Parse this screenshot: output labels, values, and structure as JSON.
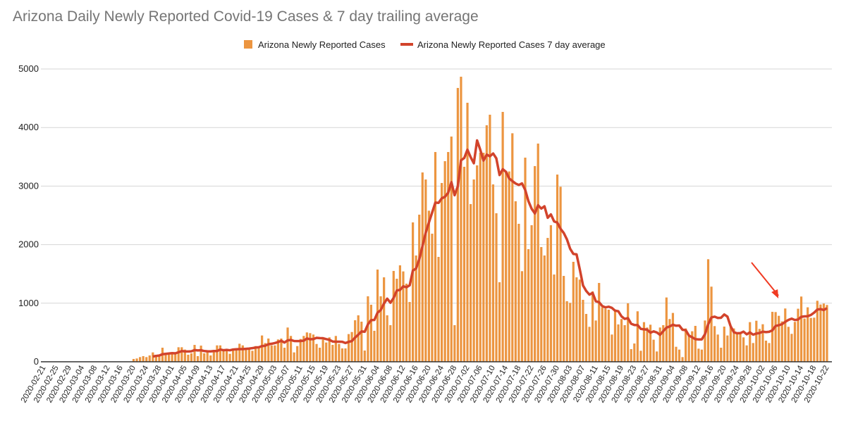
{
  "chart_data": {
    "type": "bar",
    "title": "Arizona Daily Newly Reported Covid-19 Cases & 7 day trailing average",
    "xlabel": "",
    "ylabel": "",
    "ylim": [
      0,
      5000
    ],
    "yticks": [
      0,
      1000,
      2000,
      3000,
      4000,
      5000
    ],
    "grid": true,
    "legend_position": "top",
    "colors": {
      "bars": "#ec9540",
      "line": "#d2432b",
      "annotation_arrow": "#f03a22",
      "grid": "#d6d6d6",
      "axis": "#333333"
    },
    "annotation": {
      "kind": "arrow",
      "points_to": "2020-10-06"
    },
    "tick_every_n_days": 4,
    "series": [
      {
        "name": "Arizona Newly Reported Cases",
        "type": "bar"
      },
      {
        "name": "Arizona Newly Reported Cases 7 day average",
        "type": "line",
        "window": 7
      }
    ],
    "x": [
      "2020-02-21",
      "2020-02-22",
      "2020-02-23",
      "2020-02-24",
      "2020-02-25",
      "2020-02-26",
      "2020-02-27",
      "2020-02-28",
      "2020-02-29",
      "2020-03-01",
      "2020-03-02",
      "2020-03-03",
      "2020-03-04",
      "2020-03-05",
      "2020-03-06",
      "2020-03-07",
      "2020-03-08",
      "2020-03-09",
      "2020-03-10",
      "2020-03-11",
      "2020-03-12",
      "2020-03-13",
      "2020-03-14",
      "2020-03-15",
      "2020-03-16",
      "2020-03-17",
      "2020-03-18",
      "2020-03-19",
      "2020-03-20",
      "2020-03-21",
      "2020-03-22",
      "2020-03-23",
      "2020-03-24",
      "2020-03-25",
      "2020-03-26",
      "2020-03-27",
      "2020-03-28",
      "2020-03-29",
      "2020-03-30",
      "2020-03-31",
      "2020-04-01",
      "2020-04-02",
      "2020-04-03",
      "2020-04-04",
      "2020-04-05",
      "2020-04-06",
      "2020-04-07",
      "2020-04-08",
      "2020-04-09",
      "2020-04-10",
      "2020-04-11",
      "2020-04-12",
      "2020-04-13",
      "2020-04-14",
      "2020-04-15",
      "2020-04-16",
      "2020-04-17",
      "2020-04-18",
      "2020-04-19",
      "2020-04-20",
      "2020-04-21",
      "2020-04-22",
      "2020-04-23",
      "2020-04-24",
      "2020-04-25",
      "2020-04-26",
      "2020-04-27",
      "2020-04-28",
      "2020-04-29",
      "2020-04-30",
      "2020-05-01",
      "2020-05-02",
      "2020-05-03",
      "2020-05-04",
      "2020-05-05",
      "2020-05-06",
      "2020-05-07",
      "2020-05-08",
      "2020-05-09",
      "2020-05-10",
      "2020-05-11",
      "2020-05-12",
      "2020-05-13",
      "2020-05-14",
      "2020-05-15",
      "2020-05-16",
      "2020-05-17",
      "2020-05-18",
      "2020-05-19",
      "2020-05-20",
      "2020-05-21",
      "2020-05-22",
      "2020-05-23",
      "2020-05-24",
      "2020-05-25",
      "2020-05-26",
      "2020-05-27",
      "2020-05-28",
      "2020-05-29",
      "2020-05-30",
      "2020-05-31",
      "2020-06-01",
      "2020-06-02",
      "2020-06-03",
      "2020-06-04",
      "2020-06-05",
      "2020-06-06",
      "2020-06-07",
      "2020-06-08",
      "2020-06-09",
      "2020-06-10",
      "2020-06-11",
      "2020-06-12",
      "2020-06-13",
      "2020-06-14",
      "2020-06-15",
      "2020-06-16",
      "2020-06-17",
      "2020-06-18",
      "2020-06-19",
      "2020-06-20",
      "2020-06-21",
      "2020-06-22",
      "2020-06-23",
      "2020-06-24",
      "2020-06-25",
      "2020-06-26",
      "2020-06-27",
      "2020-06-28",
      "2020-06-29",
      "2020-06-30",
      "2020-07-01",
      "2020-07-02",
      "2020-07-03",
      "2020-07-04",
      "2020-07-05",
      "2020-07-06",
      "2020-07-07",
      "2020-07-08",
      "2020-07-09",
      "2020-07-10",
      "2020-07-11",
      "2020-07-12",
      "2020-07-13",
      "2020-07-14",
      "2020-07-15",
      "2020-07-16",
      "2020-07-17",
      "2020-07-18",
      "2020-07-19",
      "2020-07-20",
      "2020-07-21",
      "2020-07-22",
      "2020-07-23",
      "2020-07-24",
      "2020-07-25",
      "2020-07-26",
      "2020-07-27",
      "2020-07-28",
      "2020-07-29",
      "2020-07-30",
      "2020-07-31",
      "2020-08-01",
      "2020-08-02",
      "2020-08-03",
      "2020-08-04",
      "2020-08-05",
      "2020-08-06",
      "2020-08-07",
      "2020-08-08",
      "2020-08-09",
      "2020-08-10",
      "2020-08-11",
      "2020-08-12",
      "2020-08-13",
      "2020-08-14",
      "2020-08-15",
      "2020-08-16",
      "2020-08-17",
      "2020-08-18",
      "2020-08-19",
      "2020-08-20",
      "2020-08-21",
      "2020-08-22",
      "2020-08-23",
      "2020-08-24",
      "2020-08-25",
      "2020-08-26",
      "2020-08-27",
      "2020-08-28",
      "2020-08-29",
      "2020-08-30",
      "2020-08-31",
      "2020-09-01",
      "2020-09-02",
      "2020-09-03",
      "2020-09-04",
      "2020-09-05",
      "2020-09-06",
      "2020-09-07",
      "2020-09-08",
      "2020-09-09",
      "2020-09-10",
      "2020-09-11",
      "2020-09-12",
      "2020-09-13",
      "2020-09-14",
      "2020-09-15",
      "2020-09-16",
      "2020-09-17",
      "2020-09-18",
      "2020-09-19",
      "2020-09-20",
      "2020-09-21",
      "2020-09-22",
      "2020-09-23",
      "2020-09-24",
      "2020-09-25",
      "2020-09-26",
      "2020-09-27",
      "2020-09-28",
      "2020-09-29",
      "2020-09-30",
      "2020-10-01",
      "2020-10-02",
      "2020-10-03",
      "2020-10-04",
      "2020-10-05",
      "2020-10-06",
      "2020-10-07",
      "2020-10-08",
      "2020-10-09",
      "2020-10-10",
      "2020-10-11",
      "2020-10-12",
      "2020-10-13",
      "2020-10-14",
      "2020-10-15",
      "2020-10-16",
      "2020-10-17",
      "2020-10-18",
      "2020-10-19",
      "2020-10-20",
      "2020-10-21",
      "2020-10-22"
    ],
    "values": [
      0,
      0,
      0,
      0,
      0,
      0,
      0,
      0,
      0,
      0,
      0,
      0,
      0,
      0,
      0,
      0,
      0,
      0,
      0,
      0,
      0,
      0,
      0,
      0,
      0,
      0,
      0,
      0,
      48,
      56,
      80,
      96,
      80,
      108,
      160,
      120,
      108,
      240,
      136,
      120,
      144,
      144,
      248,
      248,
      208,
      120,
      144,
      288,
      96,
      276,
      144,
      188,
      108,
      188,
      280,
      280,
      188,
      188,
      136,
      208,
      208,
      308,
      280,
      216,
      228,
      188,
      268,
      248,
      449,
      320,
      397,
      280,
      280,
      381,
      397,
      240,
      585,
      441,
      160,
      268,
      389,
      441,
      501,
      489,
      465,
      304,
      240,
      381,
      329,
      417,
      288,
      441,
      304,
      228,
      228,
      473,
      508,
      709,
      793,
      685,
      192,
      1118,
      974,
      529,
      1575,
      1118,
      1442,
      793,
      625,
      1551,
      1418,
      1647,
      1543,
      1334,
      1021,
      2380,
      1815,
      2512,
      3233,
      3113,
      2580,
      2187,
      3582,
      1791,
      3053,
      3426,
      3582,
      3846,
      625,
      4676,
      4868,
      3330,
      4423,
      2693,
      3113,
      3354,
      3570,
      3570,
      4039,
      4219,
      3029,
      2536,
      1358,
      4267,
      3257,
      3250,
      3902,
      2741,
      2356,
      1547,
      3486,
      1923,
      2332,
      3342,
      3726,
      1959,
      1815,
      2115,
      2332,
      1490,
      3197,
      2989,
      1466,
      1034,
      1006,
      1707,
      1442,
      1403,
      1058,
      817,
      597,
      1202,
      705,
      1346,
      930,
      906,
      890,
      465,
      870,
      638,
      730,
      625,
      998,
      216,
      312,
      862,
      188,
      677,
      585,
      633,
      377,
      176,
      585,
      625,
      1098,
      730,
      834,
      256,
      208,
      80,
      569,
      457,
      521,
      613,
      224,
      208,
      705,
      1751,
      1283,
      609,
      465,
      240,
      601,
      449,
      589,
      569,
      497,
      481,
      417,
      280,
      677,
      320,
      701,
      561,
      641,
      361,
      320,
      853,
      849,
      785,
      689,
      910,
      597,
      477,
      681,
      906,
      1114,
      738,
      930,
      749,
      753,
      1042,
      978,
      994,
      970
    ]
  }
}
